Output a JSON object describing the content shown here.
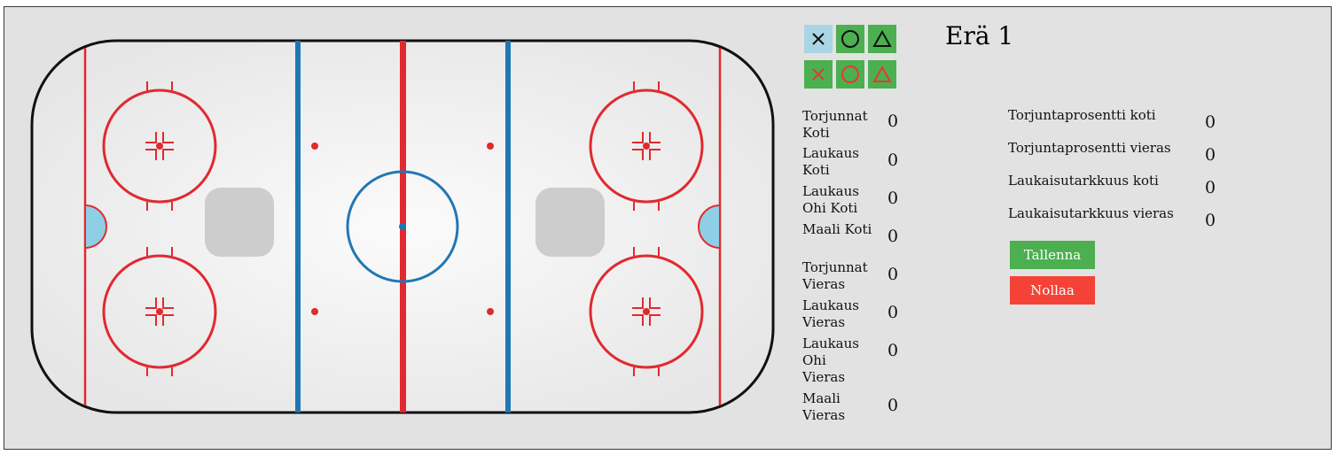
{
  "period": {
    "title": "Erä 1"
  },
  "tools": [
    {
      "name": "x-marker",
      "symbol": "x",
      "color": "#111111",
      "selected": true
    },
    {
      "name": "circle-marker",
      "symbol": "circle",
      "color": "#111111"
    },
    {
      "name": "triangle-marker",
      "symbol": "triangle",
      "color": "#111111"
    },
    {
      "name": "x-marker-red",
      "symbol": "x",
      "color": "#e53935"
    },
    {
      "name": "circle-marker-red",
      "symbol": "circle",
      "color": "#e53935"
    },
    {
      "name": "triangle-marker-red",
      "symbol": "triangle",
      "color": "#e53935"
    }
  ],
  "stats": {
    "saves_home": {
      "label": "Torjunnat Koti",
      "value": "0"
    },
    "shots_home": {
      "label": "Laukaus Koti",
      "value": "0"
    },
    "shots_missed_home": {
      "label": "Laukaus Ohi Koti",
      "value": "0"
    },
    "goals_home": {
      "label": "Maali Koti",
      "value": "0"
    },
    "saves_away": {
      "label": "Torjunnat Vieras",
      "value": "0"
    },
    "shots_away": {
      "label": "Laukaus Vieras",
      "value": "0"
    },
    "shots_missed_away": {
      "label": "Laukaus Ohi Vieras",
      "value": "0"
    },
    "goals_away": {
      "label": "Maali Vieras",
      "value": "0"
    }
  },
  "percentages": {
    "save_pct_home": {
      "label": "Torjuntaprosentti koti",
      "value": "0"
    },
    "save_pct_away": {
      "label": "Torjuntaprosentti vieras",
      "value": "0"
    },
    "shot_acc_home": {
      "label": "Laukaisutarkkuus koti",
      "value": "0"
    },
    "shot_acc_away": {
      "label": "Laukaisutarkkuus vieras",
      "value": "0"
    }
  },
  "actions": {
    "save_label": "Tallenna",
    "reset_label": "Nollaa"
  },
  "colors": {
    "green": "#4caf50",
    "red": "#f44336",
    "selected": "#a9d5e4",
    "rink_red": "#e02a2f",
    "rink_blue": "#1f78b4",
    "crease": "#8fcfe6"
  }
}
